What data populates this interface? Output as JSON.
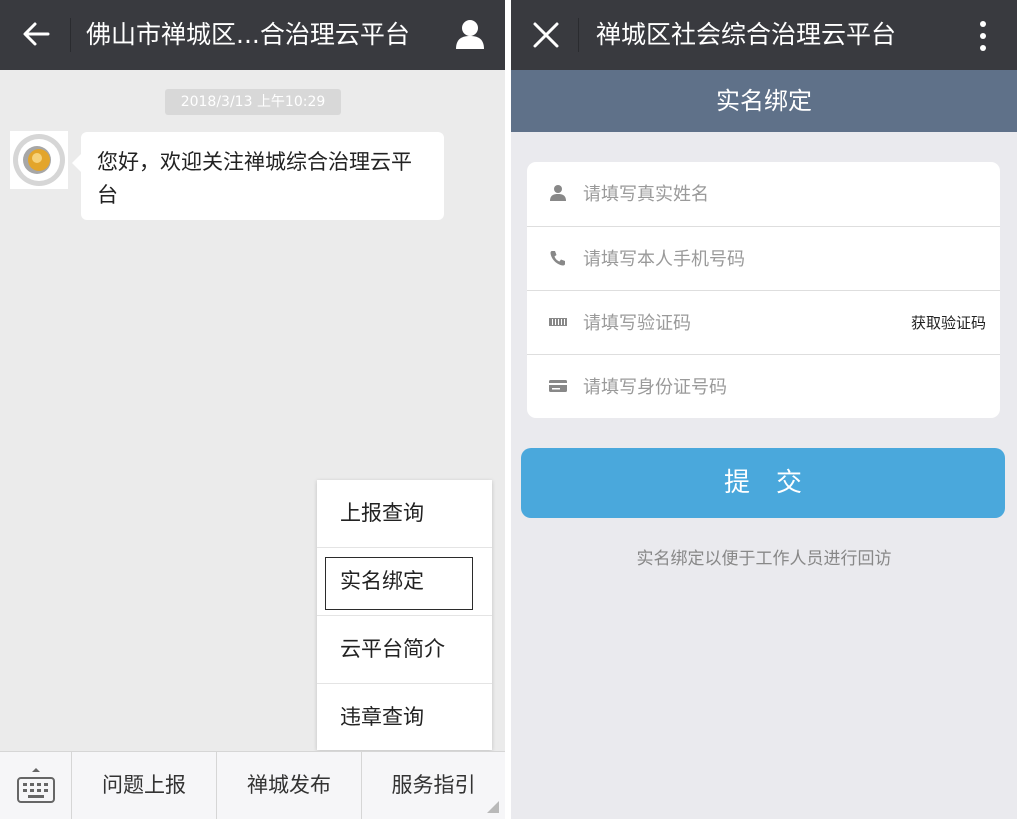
{
  "left": {
    "header": {
      "title": "佛山市禅城区...合治理云平台"
    },
    "chat": {
      "timestamp": "2018/3/13 上午10:29",
      "message": "您好，欢迎关注禅城综合治理云平台"
    },
    "popup_menu": {
      "items": [
        {
          "label": "上报查询"
        },
        {
          "label": "实名绑定"
        },
        {
          "label": "云平台简介"
        },
        {
          "label": "违章查询"
        }
      ]
    },
    "bottom_menu": {
      "items": [
        {
          "label": "问题上报"
        },
        {
          "label": "禅城发布"
        },
        {
          "label": "服务指引"
        }
      ]
    }
  },
  "right": {
    "header": {
      "title": "禅城区社会综合治理云平台"
    },
    "page_title": "实名绑定",
    "form": {
      "name_placeholder": "请填写真实姓名",
      "phone_placeholder": "请填写本人手机号码",
      "code_placeholder": "请填写验证码",
      "get_code_label": "获取验证码",
      "id_placeholder": "请填写身份证号码"
    },
    "submit_label": "提交",
    "note": "实名绑定以便于工作人员进行回访"
  },
  "colors": {
    "topbar": "#393a3f",
    "subheader": "#5f7189",
    "submit": "#4aa8dc",
    "background": "#ebebeb"
  }
}
